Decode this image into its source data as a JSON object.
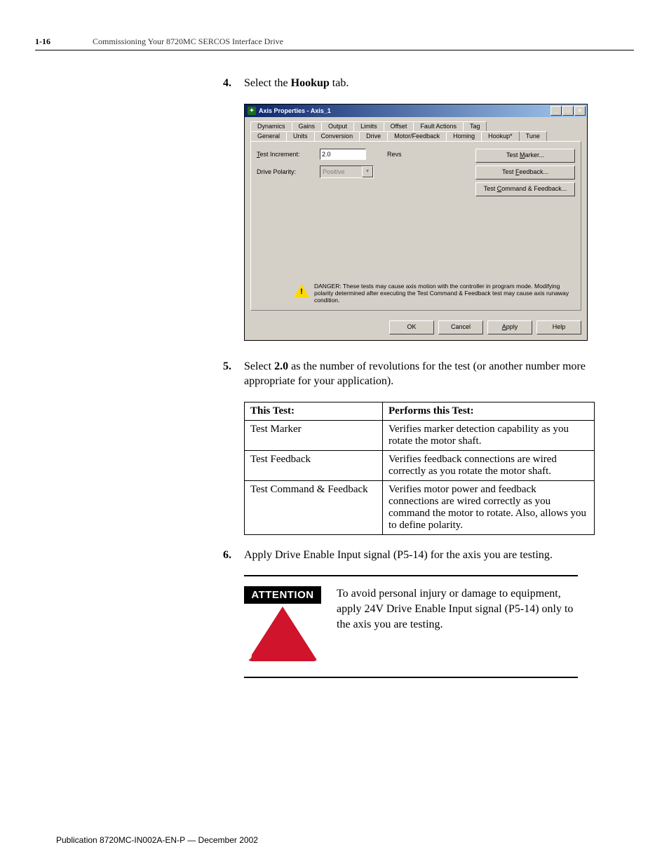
{
  "header": {
    "page_num": "1-16",
    "chapter": "Commissioning Your 8720MC SERCOS Interface Drive"
  },
  "step4": {
    "num": "4.",
    "text_before": "Select the ",
    "bold": "Hookup",
    "text_after": " tab."
  },
  "dialog": {
    "title": "Axis Properties - Axis_1",
    "tabs_row1": [
      "Dynamics",
      "Gains",
      "Output",
      "Limits",
      "Offset",
      "Fault Actions",
      "Tag"
    ],
    "tabs_row2": [
      "General",
      "Units",
      "Conversion",
      "Drive",
      "Motor/Feedback",
      "Homing",
      "Hookup*",
      "Tune"
    ],
    "test_increment_label": "Test Increment:",
    "test_increment_value": "2.0",
    "test_increment_unit": "Revs",
    "drive_polarity_label": "Drive Polarity:",
    "drive_polarity_value": "Positive",
    "btn_marker": "Test Marker...",
    "btn_feedback": "Test Feedback...",
    "btn_command": "Test Command & Feedback...",
    "danger": "DANGER: These tests may cause axis motion with the controller in program mode. Modifying polarity determined after executing the Test Command & Feedback test may cause axis runaway condition.",
    "ok": "OK",
    "cancel": "Cancel",
    "apply": "Apply",
    "help": "Help"
  },
  "step5": {
    "num": "5.",
    "text_before": "Select ",
    "bold": "2.0",
    "text_after": " as the number of revolutions for the test (or another number more appropriate for your application)."
  },
  "table": {
    "h1": "This Test:",
    "h2": "Performs this Test:",
    "rows": [
      {
        "c1": "Test Marker",
        "c2": "Verifies marker detection capability as you rotate the motor shaft."
      },
      {
        "c1": "Test Feedback",
        "c2": "Verifies feedback connections are wired correctly as you rotate the motor shaft."
      },
      {
        "c1": "Test Command & Feedback",
        "c2": "Verifies motor power and feedback connections are wired correctly as you command the motor to rotate. Also, allows you to define polarity."
      }
    ]
  },
  "step6": {
    "num": "6.",
    "text": "Apply Drive Enable Input signal (P5-14) for the axis you are testing."
  },
  "attention": {
    "label": "ATTENTION",
    "text": "To avoid personal injury or damage to equipment, apply 24V Drive Enable Input signal (P5-14) only to the axis you are testing."
  },
  "footer": "Publication 8720MC-IN002A-EN-P — December 2002"
}
